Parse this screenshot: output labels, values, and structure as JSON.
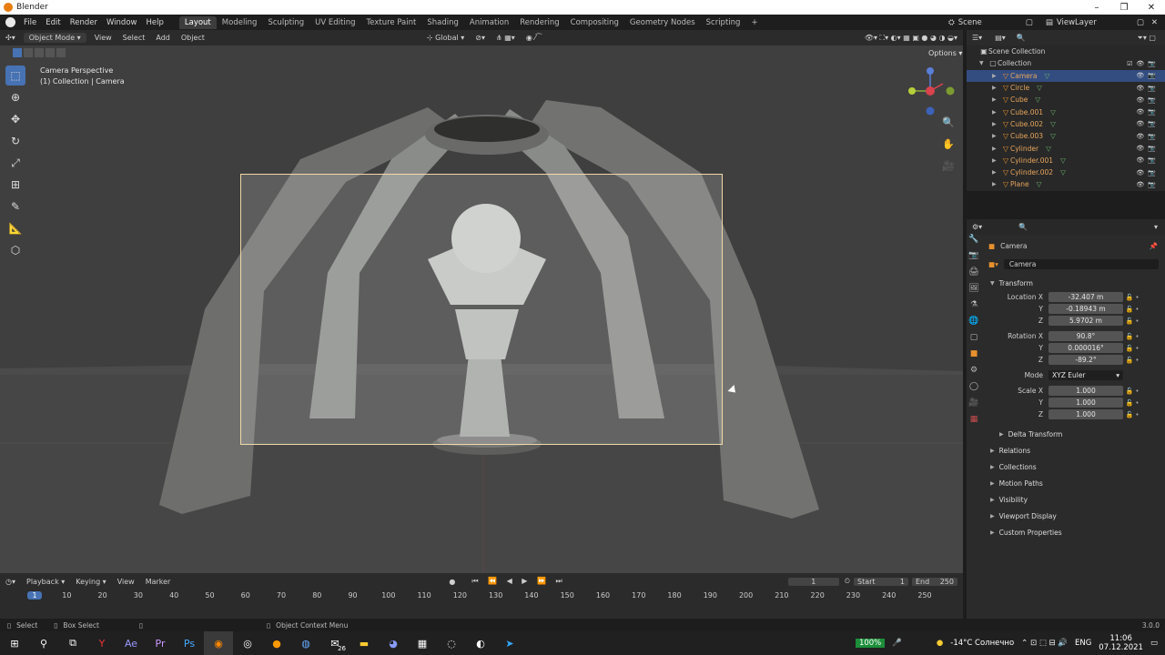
{
  "window": {
    "title": "Blender"
  },
  "menu": {
    "items": [
      "File",
      "Edit",
      "Render",
      "Window",
      "Help"
    ],
    "workspaces": [
      "Layout",
      "Modeling",
      "Sculpting",
      "UV Editing",
      "Texture Paint",
      "Shading",
      "Animation",
      "Rendering",
      "Compositing",
      "Geometry Nodes",
      "Scripting",
      "+"
    ],
    "active_workspace": "Layout",
    "scene": "Scene",
    "view_layer": "ViewLayer"
  },
  "viewport_header": {
    "mode": "Object Mode",
    "menus": [
      "View",
      "Select",
      "Add",
      "Object"
    ],
    "orientation": "Global",
    "options": "Options"
  },
  "viewport": {
    "overlay_title": "Camera Perspective",
    "overlay_sub": "(1) Collection | Camera"
  },
  "outliner": {
    "root": "Scene Collection",
    "collection": "Collection",
    "items": [
      {
        "name": "Camera",
        "selected": true
      },
      {
        "name": "Circle"
      },
      {
        "name": "Cube"
      },
      {
        "name": "Cube.001"
      },
      {
        "name": "Cube.002"
      },
      {
        "name": "Cube.003"
      },
      {
        "name": "Cylinder"
      },
      {
        "name": "Cylinder.001"
      },
      {
        "name": "Cylinder.002"
      },
      {
        "name": "Plane"
      }
    ]
  },
  "properties": {
    "object_name": "Camera",
    "data_name": "Camera",
    "transform_label": "Transform",
    "location_label": "Location X",
    "rotation_label": "Rotation X",
    "mode_label": "Mode",
    "scale_label": "Scale X",
    "y_label": "Y",
    "z_label": "Z",
    "location": [
      "-32.407 m",
      "-0.18943 m",
      "5.9702 m"
    ],
    "rotation": [
      "90.8°",
      "0.000016°",
      "-89.2°"
    ],
    "rotation_mode": "XYZ Euler",
    "scale": [
      "1.000",
      "1.000",
      "1.000"
    ],
    "sections": [
      "Delta Transform",
      "Relations",
      "Collections",
      "Motion Paths",
      "Visibility",
      "Viewport Display",
      "Custom Properties"
    ]
  },
  "timeline": {
    "menus": [
      "Playback",
      "Keying",
      "View",
      "Marker"
    ],
    "current_frame": "1",
    "start_label": "Start",
    "start": "1",
    "end_label": "End",
    "end": "250",
    "ticks": [
      "1",
      "10",
      "20",
      "30",
      "40",
      "50",
      "60",
      "70",
      "80",
      "90",
      "100",
      "110",
      "120",
      "130",
      "140",
      "150",
      "160",
      "170",
      "180",
      "190",
      "200",
      "210",
      "220",
      "230",
      "240",
      "250"
    ]
  },
  "statusbar": {
    "select": "Select",
    "box_select": "Box Select",
    "context_menu": "Object Context Menu",
    "version": "3.0.0"
  },
  "taskbar": {
    "battery": "100%",
    "weather": "-14°C  Солнечно",
    "lang": "ENG",
    "time": "11:06",
    "date": "07.12.2021",
    "badge": "26"
  }
}
